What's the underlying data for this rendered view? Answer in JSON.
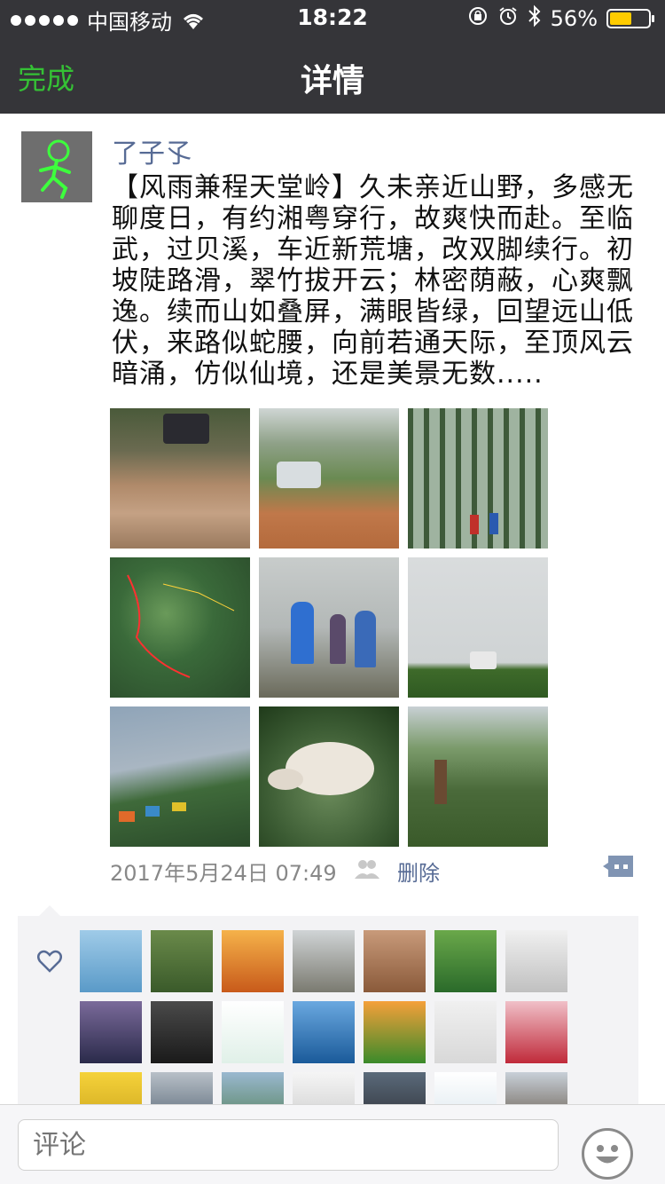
{
  "status_bar": {
    "carrier": "中国移动",
    "time": "18:22",
    "battery_percent": "56%",
    "battery_level": 0.56
  },
  "nav": {
    "done_label": "完成",
    "title": "详情"
  },
  "post": {
    "username": "了子孓",
    "text": "【风雨兼程天堂岭】久未亲近山野，多感无聊度日，有约湘粤穿行，故爽快而赴。至临武，过贝溪，车近新荒塘，改双脚续行。初坡陡路滑，翠竹拔开云；林密荫蔽，心爽飘逸。续而山如叠屏，满眼皆绿，回望远山低伏，来路似蛇腰，向前若通天际，至顶风云暗涌，仿似仙境，还是美景无数.....",
    "photos": [
      {
        "name": "muddy-road-car"
      },
      {
        "name": "car-on-dirt-road"
      },
      {
        "name": "bamboo-forest-hikers"
      },
      {
        "name": "route-map"
      },
      {
        "name": "hikers-in-fog"
      },
      {
        "name": "car-on-ridge"
      },
      {
        "name": "camp-tents-hill"
      },
      {
        "name": "white-mushrooms"
      },
      {
        "name": "pagoda-valley"
      }
    ],
    "date": "2017年5月24日 07:49",
    "delete_label": "删除"
  },
  "likes": {
    "avatars": [
      "seagulls-sea",
      "two-men-group",
      "sunset-orange",
      "woman-hiking",
      "child-family",
      "sandals-feet",
      "music-clef",
      "city-night",
      "old-portrait",
      "ink-logo",
      "blue-water",
      "green-field-sunrise",
      "woman-sunglasses",
      "red-lips-rose",
      "cartoon-face",
      "cloud-sea",
      "mountain-view",
      "ink-painting",
      "man-cap",
      "snow-scene",
      "old-house"
    ]
  },
  "comment": {
    "placeholder": "评论"
  },
  "colors": {
    "nav_bg": "#353539",
    "accent_green": "#35c135",
    "link_blue": "#576b95",
    "likes_bg": "#f3f3f5"
  }
}
